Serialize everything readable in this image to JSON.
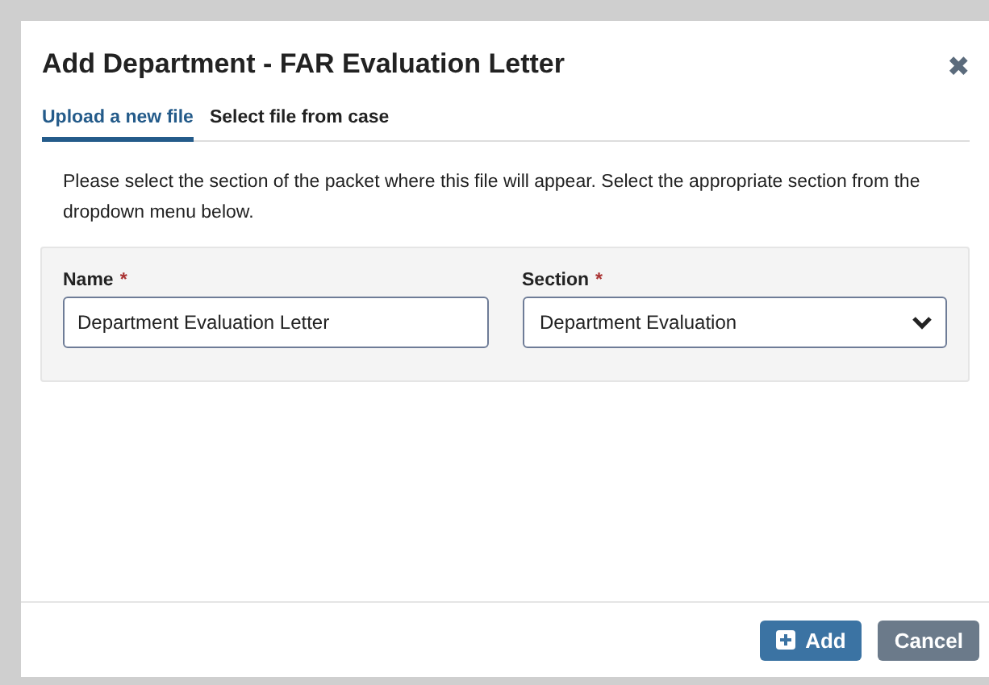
{
  "dialog": {
    "title": "Add Department - FAR Evaluation Letter",
    "close": "✖"
  },
  "tabs": [
    {
      "label": "Upload a new file",
      "selected": true
    },
    {
      "label": "Select file from case",
      "selected": false
    }
  ],
  "instructions": "Please select the section of the packet where this file will appear. Select the appropriate section from the dropdown menu below.",
  "fields": [
    {
      "kind": "text",
      "label": "Name",
      "required_mark": "*",
      "value": "Department Evaluation Letter"
    },
    {
      "kind": "select",
      "label": "Section",
      "required_mark": "*",
      "value": "Department Evaluation"
    }
  ],
  "buttons": [
    {
      "kind": "primary",
      "label": "Add"
    },
    {
      "kind": "secondary",
      "label": "Cancel"
    }
  ]
}
